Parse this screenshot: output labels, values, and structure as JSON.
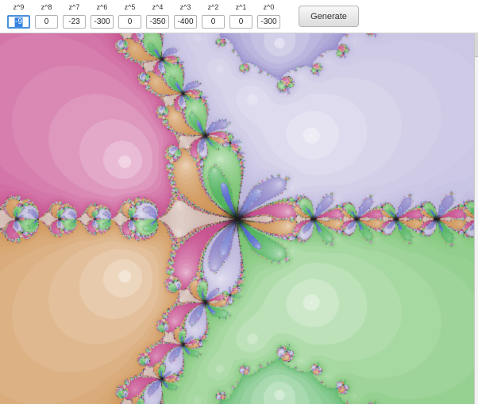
{
  "toolbar": {
    "fields": [
      {
        "label": "z^9",
        "value": "-9",
        "selected": true
      },
      {
        "label": "z^8",
        "value": "0",
        "selected": false
      },
      {
        "label": "z^7",
        "value": "-23",
        "selected": false
      },
      {
        "label": "z^6",
        "value": "-300",
        "selected": false
      },
      {
        "label": "z^5",
        "value": "0",
        "selected": false
      },
      {
        "label": "z^4",
        "value": "-350",
        "selected": false
      },
      {
        "label": "z^3",
        "value": "-400",
        "selected": false
      },
      {
        "label": "z^2",
        "value": "0",
        "selected": false
      },
      {
        "label": "z^1",
        "value": "0",
        "selected": false
      },
      {
        "label": "z^0",
        "value": "-300",
        "selected": false
      }
    ],
    "generate_label": "Generate",
    "selection_color": "#3584e4",
    "focus_border_color": "#4a90d9"
  },
  "fractal": {
    "type": "newton",
    "max_iterations": 60,
    "view": {
      "center_re": 0,
      "center_im": 0,
      "half_width": 1.75
    },
    "palette": [
      {
        "name": "orange",
        "color": "#cf9455",
        "angle_deg": -135
      },
      {
        "name": "green",
        "color": "#4fb35e",
        "angle_deg": -95
      },
      {
        "name": "light-green",
        "color": "#79c472",
        "angle_deg": -50
      },
      {
        "name": "blue",
        "color": "#5467cb",
        "angle_deg": -8
      },
      {
        "name": "pale-lavender",
        "color": "#bcb6dc",
        "angle_deg": 38
      },
      {
        "name": "slate-purple",
        "color": "#8a82c6",
        "angle_deg": 85
      },
      {
        "name": "violet-blue",
        "color": "#7d86d2",
        "angle_deg": 122
      },
      {
        "name": "pink",
        "color": "#c64d8e",
        "angle_deg": 152
      },
      {
        "name": "cream",
        "color": "#cdb4ab",
        "angle_deg": 180
      }
    ],
    "nonconverged_color": "#1c1c1c"
  }
}
